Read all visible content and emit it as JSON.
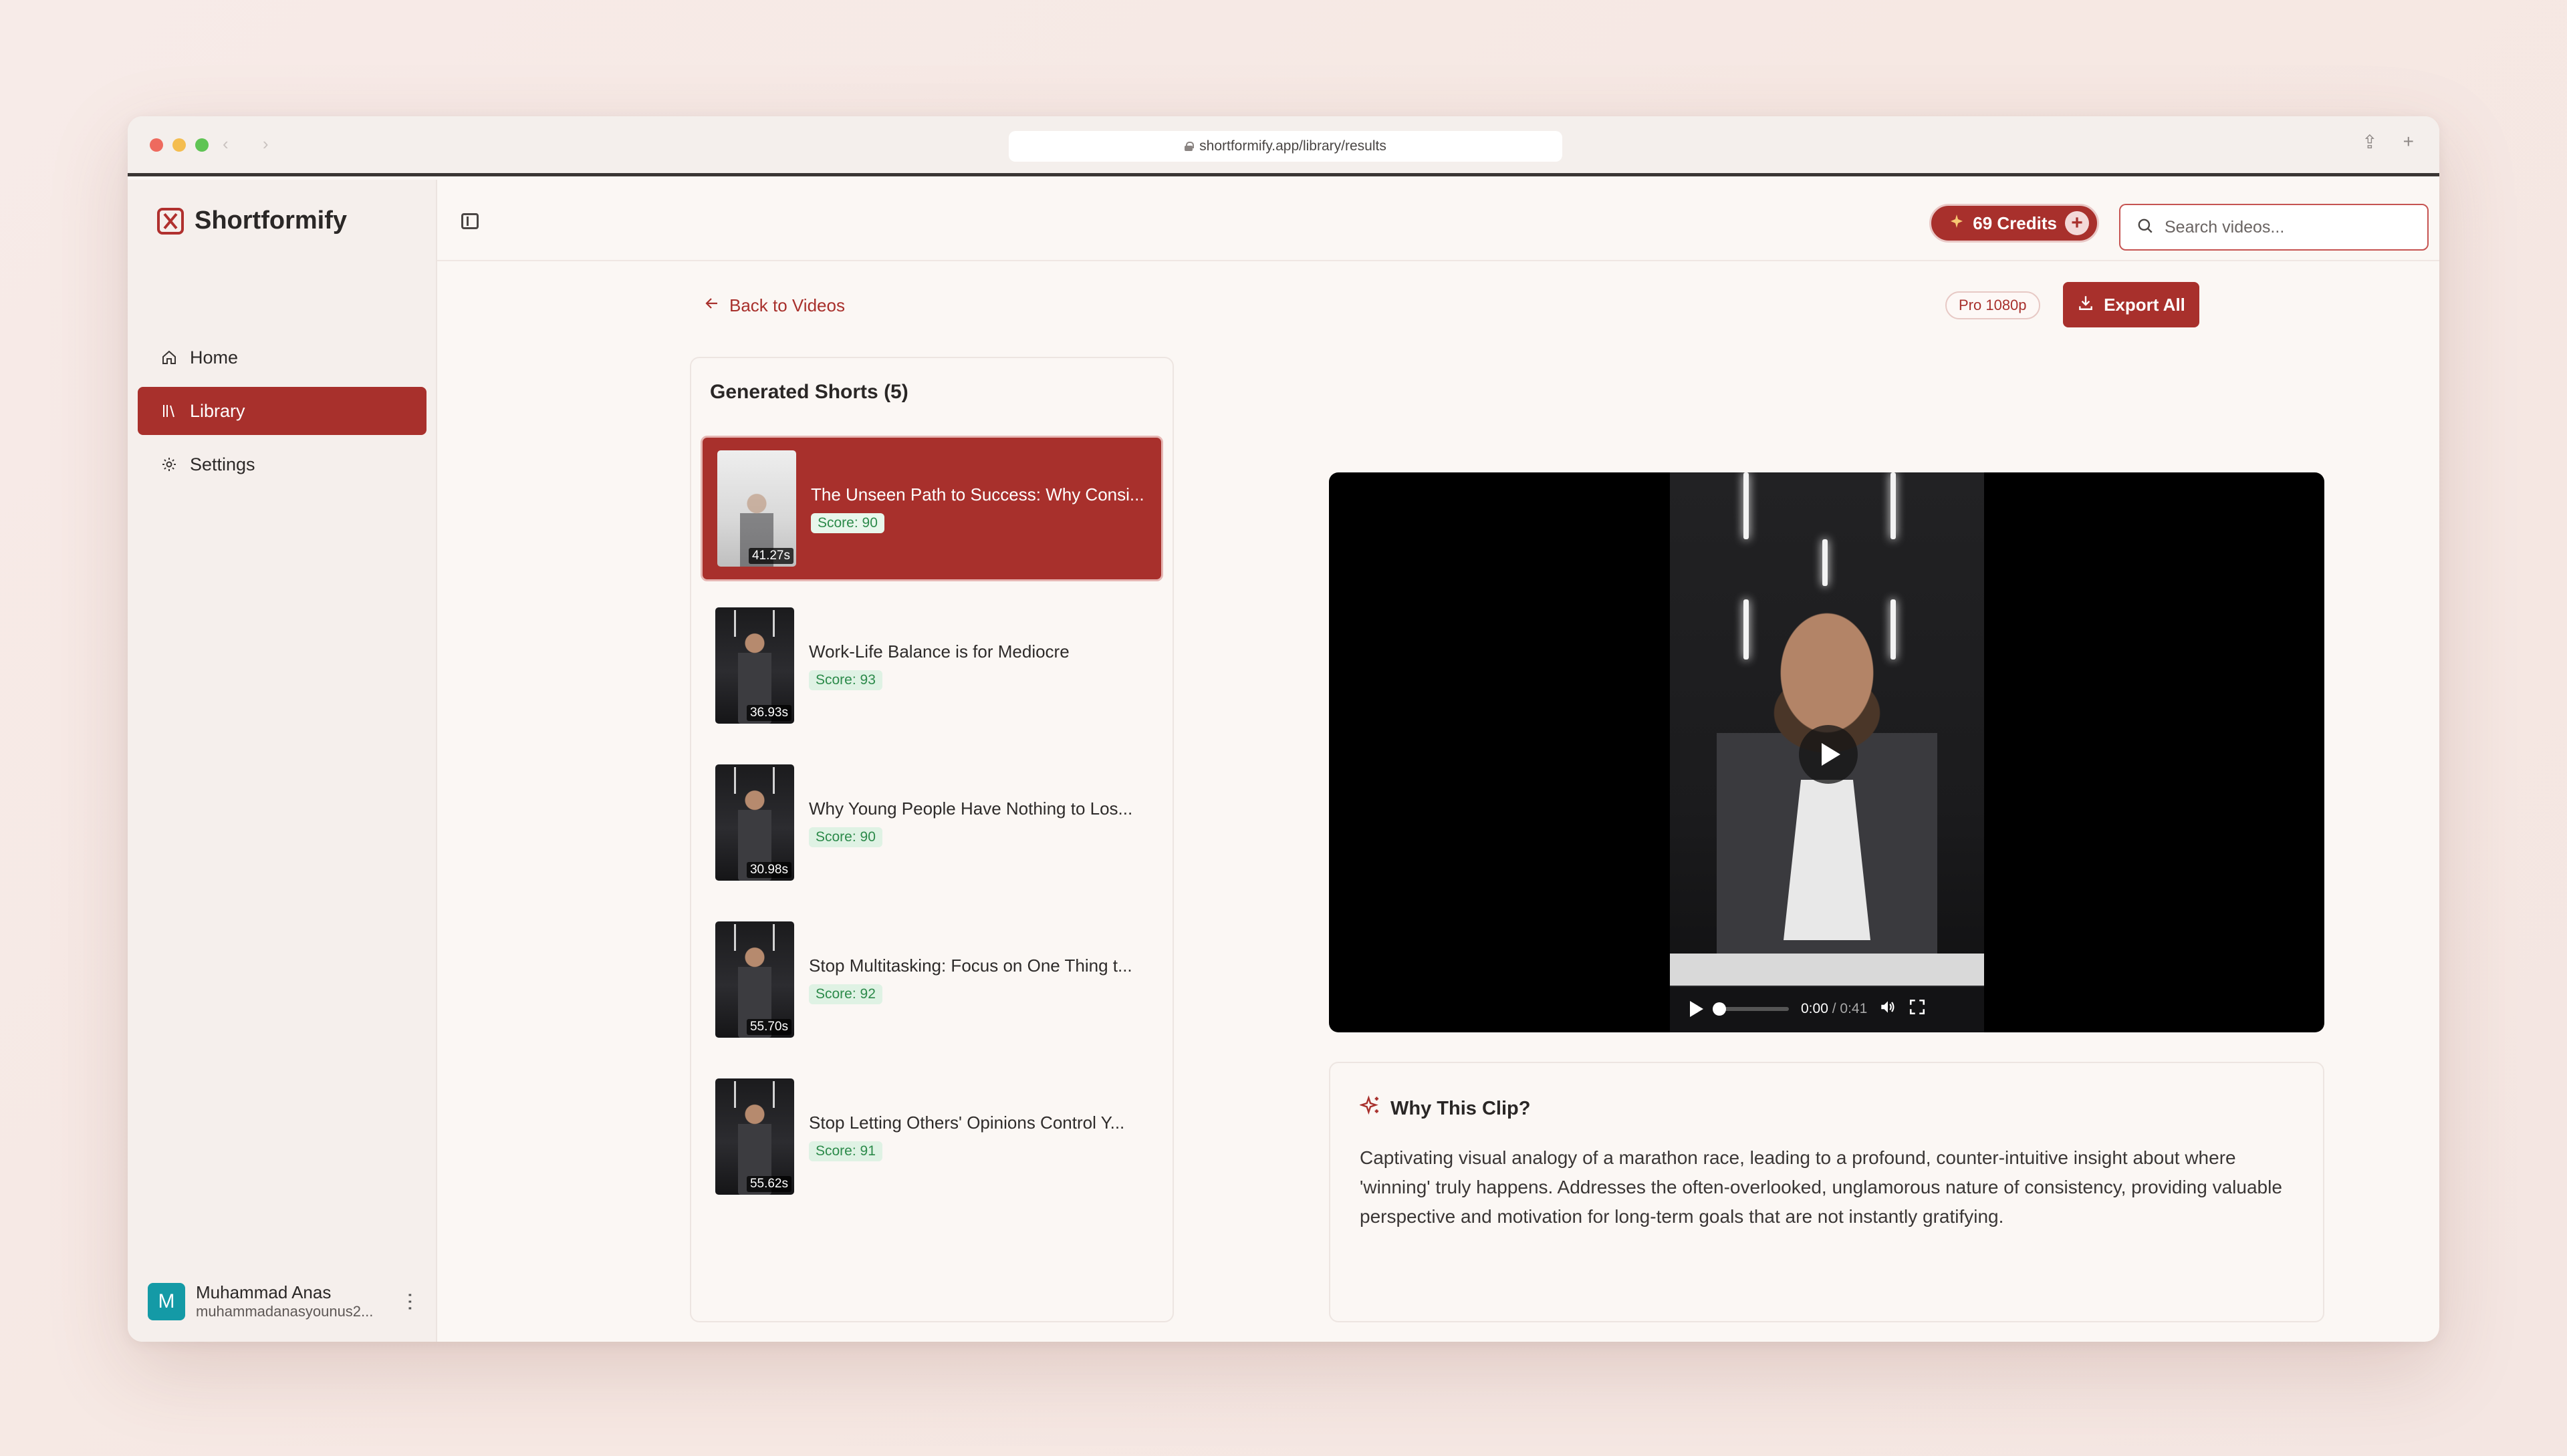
{
  "browser": {
    "url": "shortformify.app/library/results",
    "nav_glyphs": "‹ ›",
    "share_glyph": "⇪",
    "new_tab_glyph": "+"
  },
  "brand": {
    "name": "Shortformify",
    "logo_icon": "scissors-logo-icon"
  },
  "sidebar": {
    "items": [
      {
        "label": "Home",
        "icon": "home-icon",
        "active": false
      },
      {
        "label": "Library",
        "icon": "library-icon",
        "active": true
      },
      {
        "label": "Settings",
        "icon": "gear-icon",
        "active": false
      }
    ],
    "user": {
      "initial": "M",
      "name": "Muhammad Anas",
      "email": "muhammadanasyounus2..."
    }
  },
  "header": {
    "credits_label": "69 Credits",
    "credits_plus": "+",
    "search_placeholder": "Search videos..."
  },
  "content": {
    "back_label": "Back to Videos",
    "quality_badge": "Pro 1080p",
    "export_label": "Export All",
    "shorts_title": "Generated Shorts (5)",
    "shorts": [
      {
        "title": "The Unseen Path to Success: Why Consi...",
        "score": "Score: 90",
        "duration": "41.27s",
        "active": true
      },
      {
        "title": "Work-Life Balance is for Mediocre",
        "score": "Score: 93",
        "duration": "36.93s",
        "active": false
      },
      {
        "title": "Why Young People Have Nothing to Los...",
        "score": "Score: 90",
        "duration": "30.98s",
        "active": false
      },
      {
        "title": "Stop Multitasking: Focus on One Thing t...",
        "score": "Score: 92",
        "duration": "55.70s",
        "active": false
      },
      {
        "title": "Stop Letting Others' Opinions Control Y...",
        "score": "Score: 91",
        "duration": "55.62s",
        "active": false
      }
    ],
    "player": {
      "current_time": "0:00",
      "separator": " / ",
      "total_time": "0:41",
      "progress": 0
    },
    "why": {
      "title": "Why This Clip?",
      "text": "Captivating visual analogy of a marathon race, leading to a profound, counter-intuitive insight about where 'winning' truly happens. Addresses the often-overlooked, unglamorous nature of consistency, providing valuable perspective and motivation for long-term goals that are not instantly gratifying."
    }
  },
  "colors": {
    "accent": "#a8302c",
    "score_green": "#2c8a4a",
    "avatar": "#149aa6"
  }
}
